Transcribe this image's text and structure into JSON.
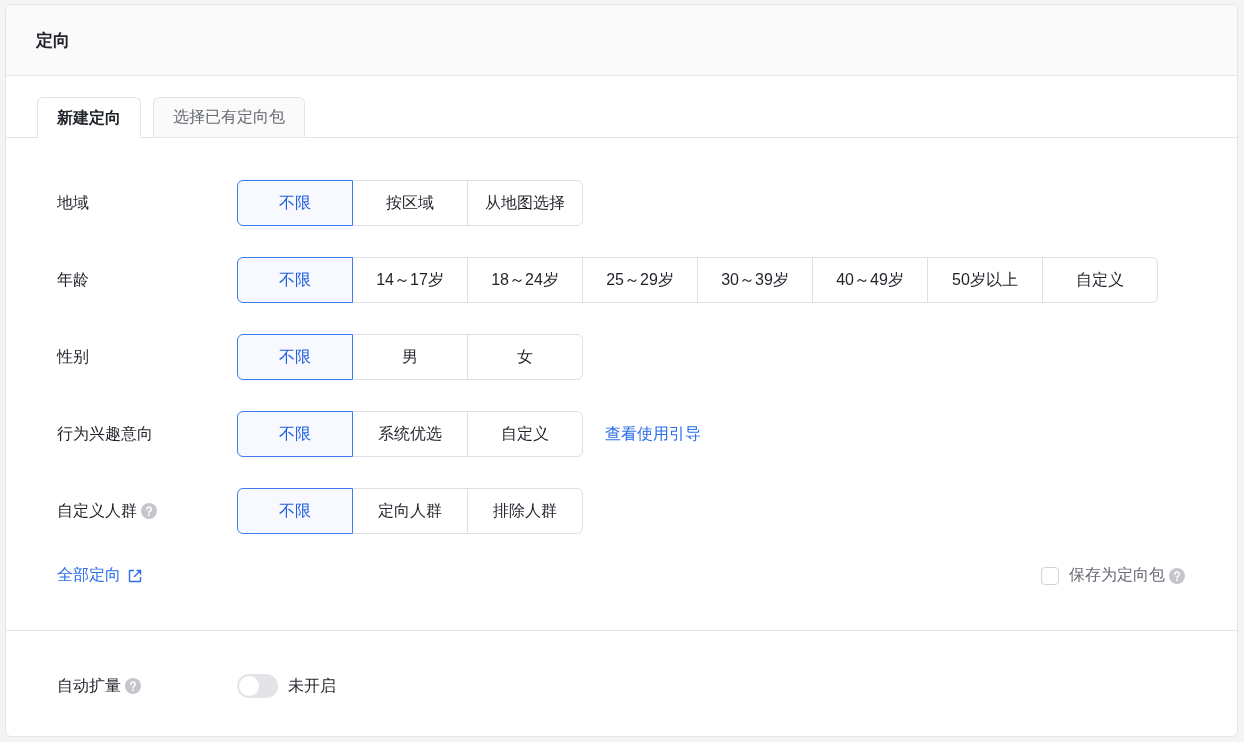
{
  "header": {
    "title": "定向"
  },
  "tabs": [
    {
      "label": "新建定向",
      "selected": true
    },
    {
      "label": "选择已有定向包",
      "selected": false
    }
  ],
  "rows": [
    {
      "label": "地域",
      "help": false,
      "options": [
        {
          "label": "不限",
          "selected": true
        },
        {
          "label": "按区域",
          "selected": false
        },
        {
          "label": "从地图选择",
          "selected": false
        }
      ]
    },
    {
      "label": "年龄",
      "help": false,
      "options": [
        {
          "label": "不限",
          "selected": true
        },
        {
          "label": "14～17岁",
          "selected": false
        },
        {
          "label": "18～24岁",
          "selected": false
        },
        {
          "label": "25～29岁",
          "selected": false
        },
        {
          "label": "30～39岁",
          "selected": false
        },
        {
          "label": "40～49岁",
          "selected": false
        },
        {
          "label": "50岁以上",
          "selected": false
        },
        {
          "label": "自定义",
          "selected": false
        }
      ]
    },
    {
      "label": "性别",
      "help": false,
      "options": [
        {
          "label": "不限",
          "selected": true
        },
        {
          "label": "男",
          "selected": false
        },
        {
          "label": "女",
          "selected": false
        }
      ]
    },
    {
      "label": "行为兴趣意向",
      "help": false,
      "options": [
        {
          "label": "不限",
          "selected": true
        },
        {
          "label": "系统优选",
          "selected": false
        },
        {
          "label": "自定义",
          "selected": false
        }
      ],
      "link": "查看使用引导"
    },
    {
      "label": "自定义人群",
      "help": true,
      "options": [
        {
          "label": "不限",
          "selected": true
        },
        {
          "label": "定向人群",
          "selected": false
        },
        {
          "label": "排除人群",
          "selected": false
        }
      ]
    }
  ],
  "all_targeting_link": "全部定向",
  "save_package": {
    "label": "保存为定向包",
    "checked": false,
    "help": true
  },
  "auto_expand": {
    "label": "自动扩量",
    "help": true,
    "on": false,
    "status": "未开启"
  }
}
